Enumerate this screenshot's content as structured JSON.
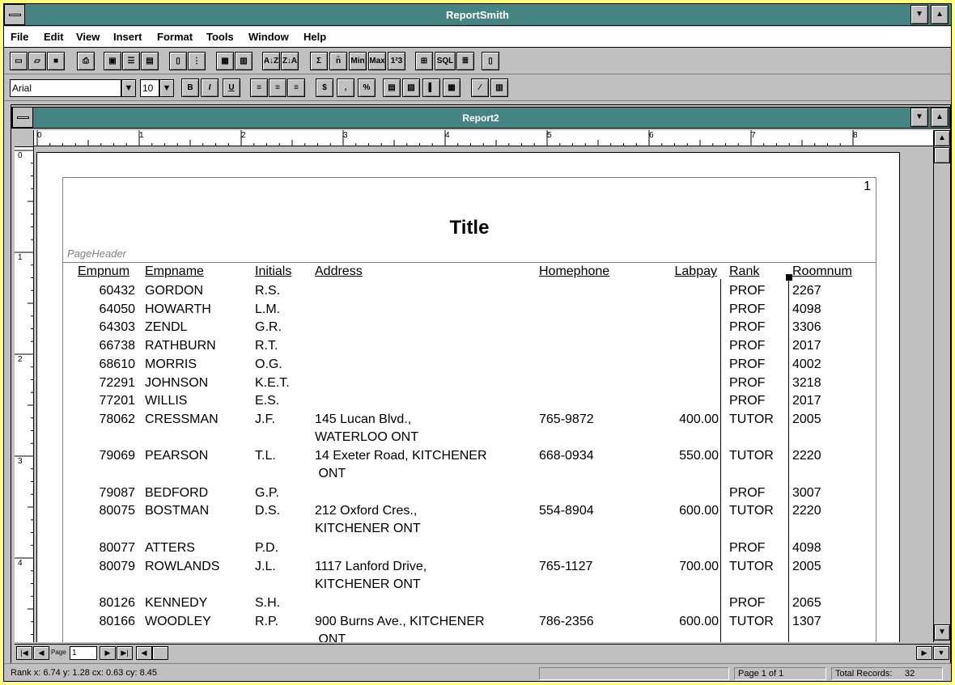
{
  "app": {
    "title": "ReportSmith"
  },
  "menu": [
    "File",
    "Edit",
    "View",
    "Insert",
    "Format",
    "Tools",
    "Window",
    "Help"
  ],
  "toolbar1": {
    "buttons": [
      "new-icon",
      "open-icon",
      "save-icon",
      "print-icon",
      "print-preview-icon",
      "report-columnar-icon",
      "report-form-icon",
      "report-label-icon",
      "page-width-icon",
      "zoom-icon",
      "fields-icon",
      "derived-field-icon",
      "sort-ascending-icon",
      "sort-descending-icon",
      "sum-icon",
      "average-icon",
      "min-icon",
      "max-icon",
      "count-icon",
      "tables-icon",
      "sql-icon",
      "selection-icon",
      "report-query-icon"
    ],
    "sort_asc": "A↓Z",
    "sort_desc": "Z↓A",
    "sum": "Σ",
    "avg": "n̄",
    "min": "Min",
    "max": "Max",
    "count": "1²3",
    "sql": "SQL"
  },
  "toolbar2": {
    "font": "Arial",
    "size": "10",
    "bold": "B",
    "italic": "I",
    "underline": "U",
    "currency": "$",
    "comma": ",",
    "percent": "%"
  },
  "report": {
    "window_title": "Report2",
    "page_number": "1",
    "title": "Title",
    "section_label": "PageHeader",
    "columns": [
      "Empnum",
      "Empname",
      "Initials",
      "Address",
      "Homephone",
      "Labpay",
      "Rank",
      "Roomnum"
    ],
    "rows": [
      {
        "empnum": "60432",
        "name": "GORDON",
        "init": "R.S.",
        "addr1": "",
        "addr2": "",
        "phone": "",
        "pay": "",
        "rank": "PROF",
        "room": "2267"
      },
      {
        "empnum": "64050",
        "name": "HOWARTH",
        "init": "L.M.",
        "addr1": "",
        "addr2": "",
        "phone": "",
        "pay": "",
        "rank": "PROF",
        "room": "4098"
      },
      {
        "empnum": "64303",
        "name": "ZENDL",
        "init": "G.R.",
        "addr1": "",
        "addr2": "",
        "phone": "",
        "pay": "",
        "rank": "PROF",
        "room": "3306"
      },
      {
        "empnum": "66738",
        "name": "RATHBURN",
        "init": "R.T.",
        "addr1": "",
        "addr2": "",
        "phone": "",
        "pay": "",
        "rank": "PROF",
        "room": "2017"
      },
      {
        "empnum": "68610",
        "name": "MORRIS",
        "init": "O.G.",
        "addr1": "",
        "addr2": "",
        "phone": "",
        "pay": "",
        "rank": "PROF",
        "room": "4002"
      },
      {
        "empnum": "72291",
        "name": "JOHNSON",
        "init": "K.E.T.",
        "addr1": "",
        "addr2": "",
        "phone": "",
        "pay": "",
        "rank": "PROF",
        "room": "3218"
      },
      {
        "empnum": "77201",
        "name": "WILLIS",
        "init": "E.S.",
        "addr1": "",
        "addr2": "",
        "phone": "",
        "pay": "",
        "rank": "PROF",
        "room": "2017"
      },
      {
        "empnum": "78062",
        "name": "CRESSMAN",
        "init": "J.F.",
        "addr1": "145 Lucan Blvd.,",
        "addr2": "WATERLOO ONT",
        "phone": "765-9872",
        "pay": "400.00",
        "rank": "TUTOR",
        "room": "2005"
      },
      {
        "empnum": "79069",
        "name": "PEARSON",
        "init": "T.L.",
        "addr1": "14 Exeter Road, KITCHENER",
        "addr2": " ONT",
        "phone": "668-0934",
        "pay": "550.00",
        "rank": "TUTOR",
        "room": "2220"
      },
      {
        "empnum": "79087",
        "name": "BEDFORD",
        "init": "G.P.",
        "addr1": "",
        "addr2": "",
        "phone": "",
        "pay": "",
        "rank": "PROF",
        "room": "3007"
      },
      {
        "empnum": "80075",
        "name": "BOSTMAN",
        "init": "D.S.",
        "addr1": "212 Oxford Cres.,",
        "addr2": "KITCHENER ONT",
        "phone": "554-8904",
        "pay": "600.00",
        "rank": "TUTOR",
        "room": "2220"
      },
      {
        "empnum": "80077",
        "name": "ATTERS",
        "init": "P.D.",
        "addr1": "",
        "addr2": "",
        "phone": "",
        "pay": "",
        "rank": "PROF",
        "room": "4098"
      },
      {
        "empnum": "80079",
        "name": "ROWLANDS",
        "init": "J.L.",
        "addr1": "1117 Lanford Drive,",
        "addr2": "KITCHENER ONT",
        "phone": "765-1127",
        "pay": "700.00",
        "rank": "TUTOR",
        "room": "2005"
      },
      {
        "empnum": "80126",
        "name": "KENNEDY",
        "init": "S.H.",
        "addr1": "",
        "addr2": "",
        "phone": "",
        "pay": "",
        "rank": "PROF",
        "room": "2065"
      },
      {
        "empnum": "80166",
        "name": "WOODLEY",
        "init": "R.P.",
        "addr1": "900 Burns Ave., KITCHENER",
        "addr2": " ONT",
        "phone": "786-2356",
        "pay": "600.00",
        "rank": "TUTOR",
        "room": "1307"
      }
    ]
  },
  "rulers": {
    "horizontal": [
      "0",
      "1",
      "2",
      "3",
      "4",
      "5",
      "6",
      "7",
      "8"
    ],
    "vertical": [
      "0",
      "1",
      "2",
      "3",
      "4"
    ]
  },
  "navigation": {
    "page_label": "Page",
    "page_value": "1"
  },
  "status": {
    "field": "Rank   x: 6.74 y: 1.28 cx: 0.63 cy: 8.45",
    "page": "Page 1 of 1",
    "records_label": "Total Records:",
    "records_value": "32"
  }
}
